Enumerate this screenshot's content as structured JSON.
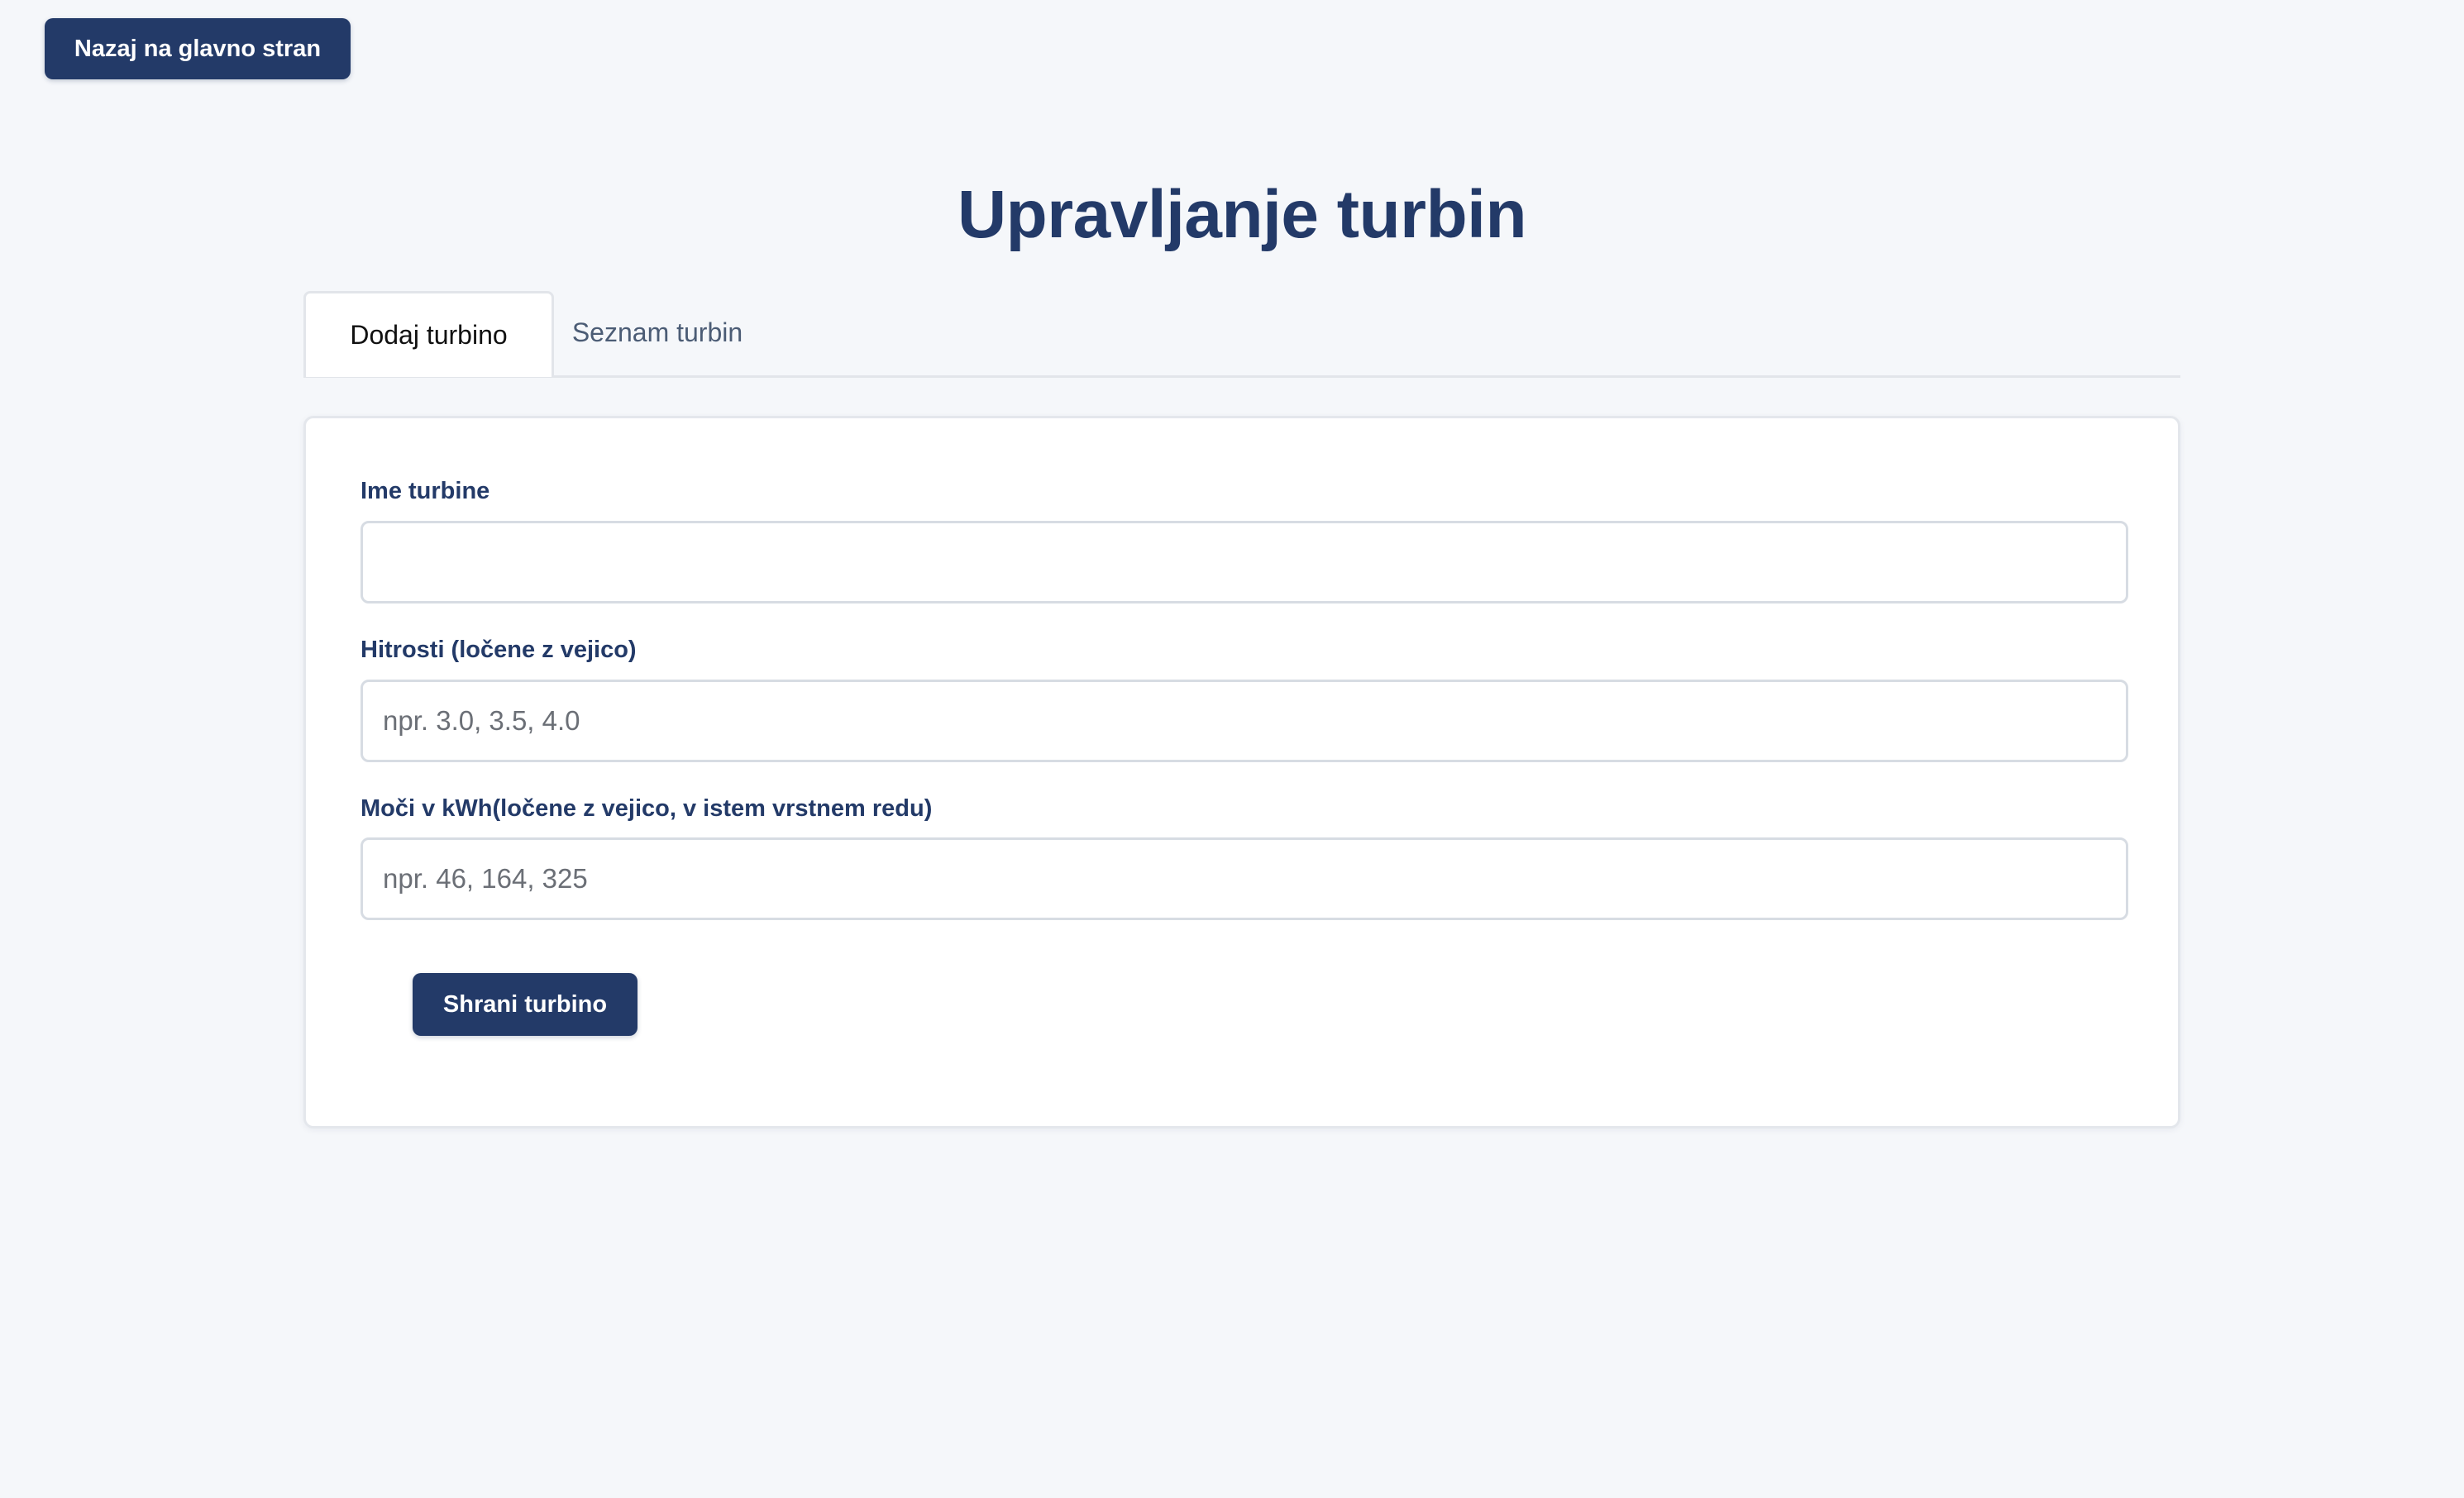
{
  "header": {
    "back_label": "Nazaj na glavno stran",
    "title": "Upravljanje turbin"
  },
  "tabs": [
    {
      "label": "Dodaj turbino",
      "active": true
    },
    {
      "label": "Seznam turbin",
      "active": false
    }
  ],
  "form": {
    "fields": [
      {
        "label": "Ime turbine",
        "value": "",
        "placeholder": ""
      },
      {
        "label": "Hitrosti (ločene z vejico)",
        "value": "",
        "placeholder": "npr. 3.0, 3.5, 4.0"
      },
      {
        "label": "Moči v kWh(ločene z vejico, v istem vrstnem redu)",
        "value": "",
        "placeholder": "npr. 46, 164, 325"
      }
    ],
    "submit_label": "Shrani turbino"
  },
  "colors": {
    "primary": "#233a68",
    "background": "#f5f7fa",
    "card": "#ffffff",
    "border": "#e2e5ea"
  }
}
